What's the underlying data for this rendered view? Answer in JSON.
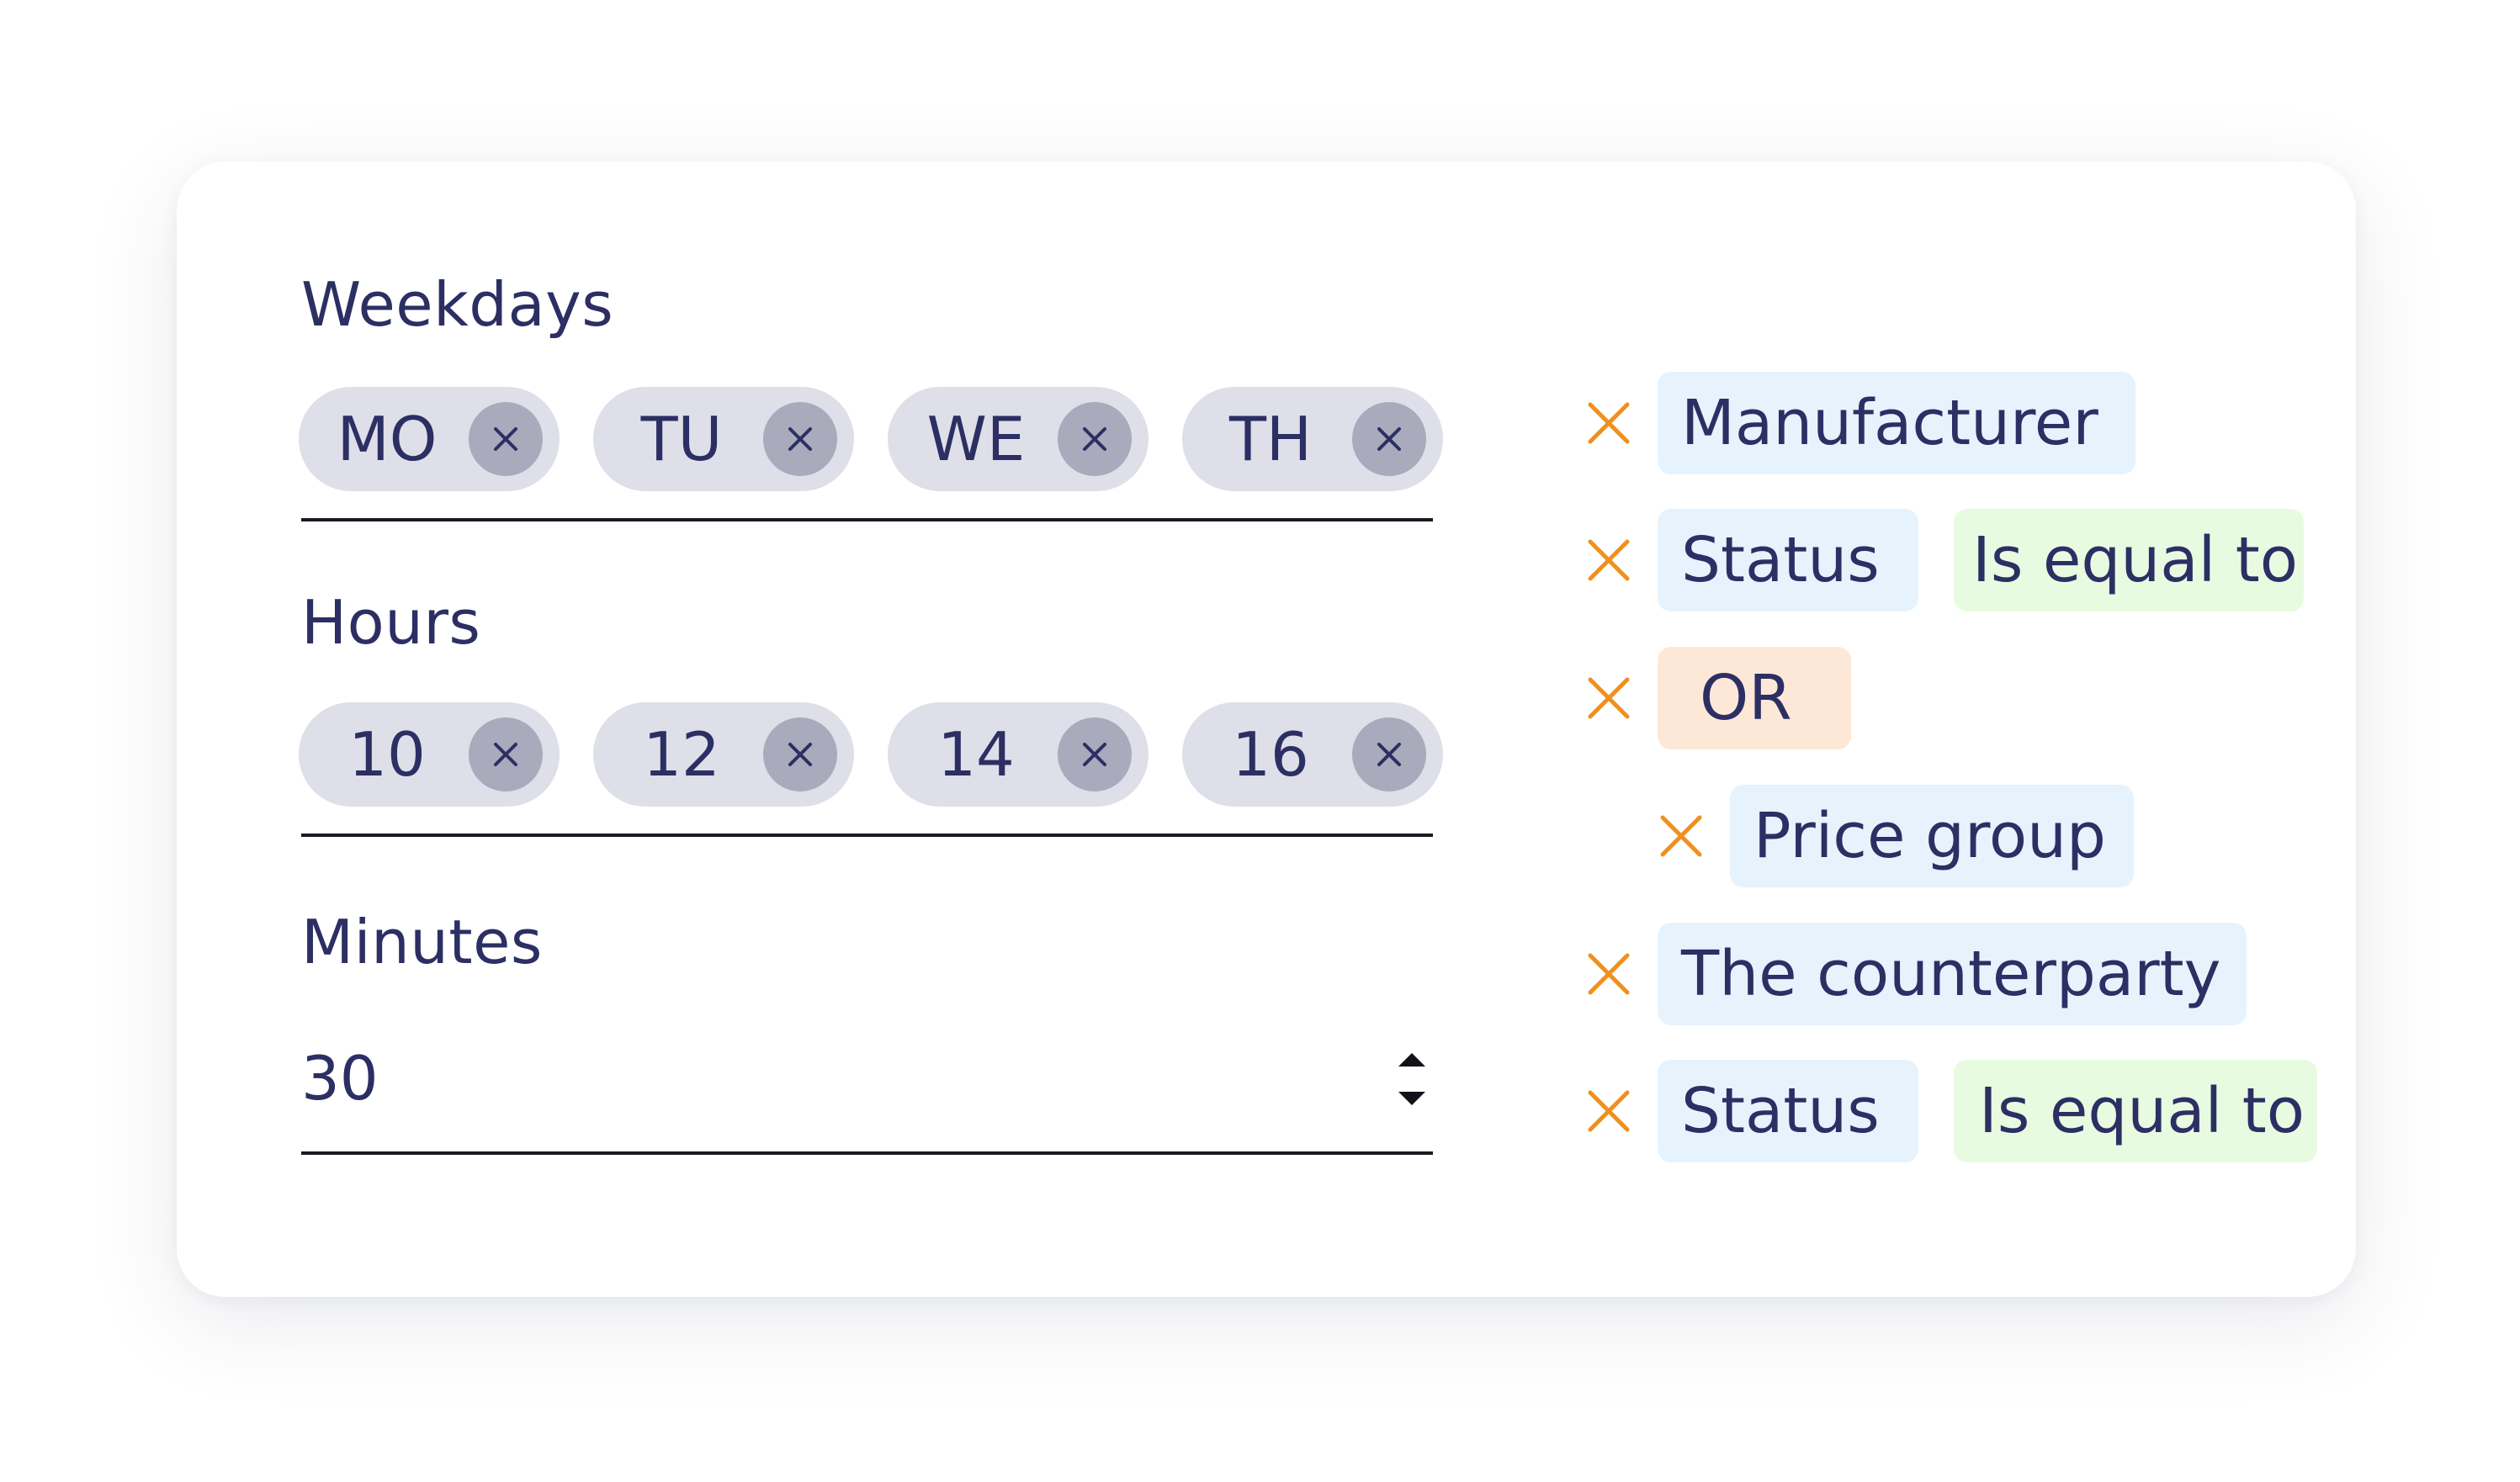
{
  "schedule": {
    "weekdays": {
      "label": "Weekdays",
      "chips": [
        "MO",
        "TU",
        "WE",
        "TH"
      ]
    },
    "hours": {
      "label": "Hours",
      "chips": [
        "10",
        "12",
        "14",
        "16"
      ]
    },
    "minutes": {
      "label": "Minutes",
      "value": "30"
    }
  },
  "filters": [
    {
      "field": "Manufacturer"
    },
    {
      "field": "Status",
      "operator": "Is equal to"
    },
    {
      "group": "OR"
    },
    {
      "field": "Price group",
      "indented": true
    },
    {
      "field": "The counterparty"
    },
    {
      "field": "Status",
      "operator": "Is equal to"
    }
  ],
  "colors": {
    "text": "#2c2f63",
    "chip_background": "#dedfe8",
    "chip_remove_background": "#a9aabb",
    "remove_icon_accent": "#f0901e",
    "field_tag": "#e6f3fd",
    "operator_tag": "#e7fbe1",
    "group_tag": "#fde8d7"
  },
  "icons": {
    "chip_remove": "close-icon",
    "filter_remove": "close-icon",
    "spinner": "up-down-arrows-icon"
  }
}
